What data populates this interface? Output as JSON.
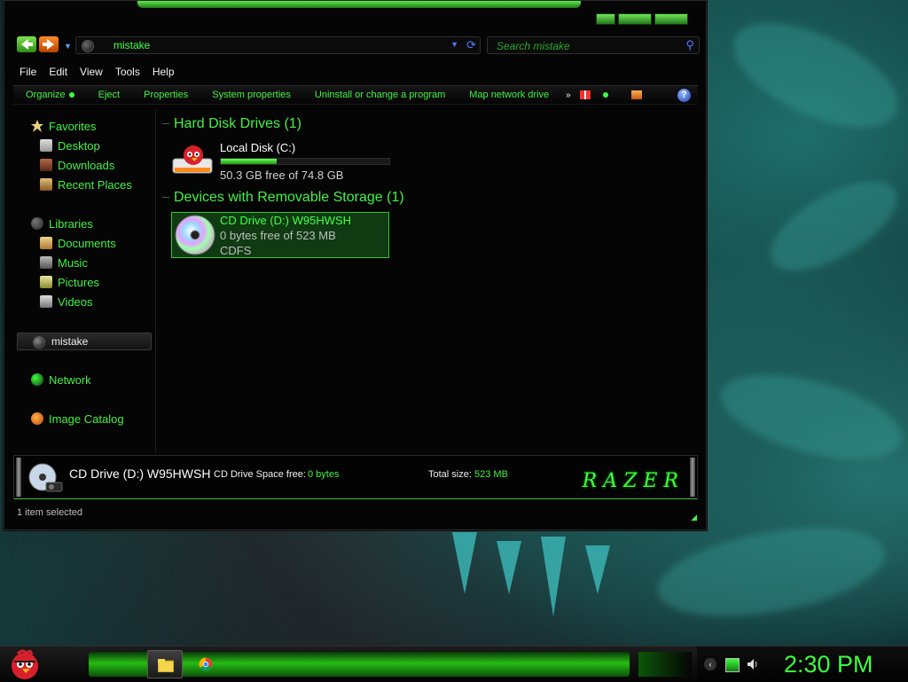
{
  "window": {
    "address": {
      "current_folder": "mistake"
    },
    "search": {
      "placeholder": "Search mistake"
    }
  },
  "menubar": {
    "items": [
      "File",
      "Edit",
      "View",
      "Tools",
      "Help"
    ]
  },
  "commandbar": {
    "items": [
      "Organize",
      "Eject",
      "Properties",
      "System properties",
      "Uninstall or change a program",
      "Map network drive"
    ],
    "more": "»",
    "help": "?"
  },
  "sidebar": {
    "favorites": {
      "label": "Favorites",
      "items": [
        "Desktop",
        "Downloads",
        "Recent Places"
      ]
    },
    "libraries": {
      "label": "Libraries",
      "items": [
        "Documents",
        "Music",
        "Pictures",
        "Videos"
      ]
    },
    "selected": "mistake",
    "network": "Network",
    "image_catalog": "Image Catalog"
  },
  "content": {
    "hard_disk_group": "Hard Disk Drives (1)",
    "local_disk": {
      "name": "Local Disk (C:)",
      "free_text": "50.3 GB free of 74.8 GB",
      "used_fraction": 0.33
    },
    "removable_group": "Devices with Removable Storage (1)",
    "cd_drive": {
      "name": "CD Drive (D:) W95HWSH",
      "free_text": "0 bytes free of 523 MB",
      "filesystem": "CDFS"
    }
  },
  "details": {
    "title": "CD Drive (D:) W95HWSH",
    "space_label": "CD Drive Space free:",
    "space_value": "0 bytes",
    "total_label": "Total size:",
    "total_value": "523 MB",
    "logo": "RAZER"
  },
  "status": {
    "text": "1 item selected"
  },
  "taskbar": {
    "clock": "2:30 PM"
  },
  "colors": {
    "accent": "#44f044",
    "selection_bg": "#0f3a12",
    "background": "#050505"
  }
}
